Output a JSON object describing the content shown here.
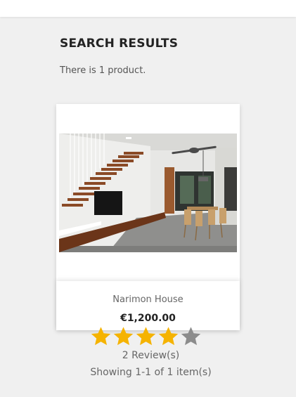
{
  "header": {
    "title": "SEARCH RESULTS",
    "result_count": "There is 1 product."
  },
  "products": [
    {
      "name": "Narimon House",
      "price": "€1,200.00",
      "rating": 4,
      "rating_max": 5,
      "reviews": "2 Review(s)"
    }
  ],
  "pagination": {
    "showing": "Showing 1-1 of 1 item(s)"
  },
  "colors": {
    "background": "#f0f0f0",
    "star_filled": "#f5b301",
    "star_empty": "#8c8c8c",
    "title": "#232323"
  },
  "icons": {
    "star_filled": "star-filled-icon",
    "star_empty": "star-empty-icon"
  }
}
